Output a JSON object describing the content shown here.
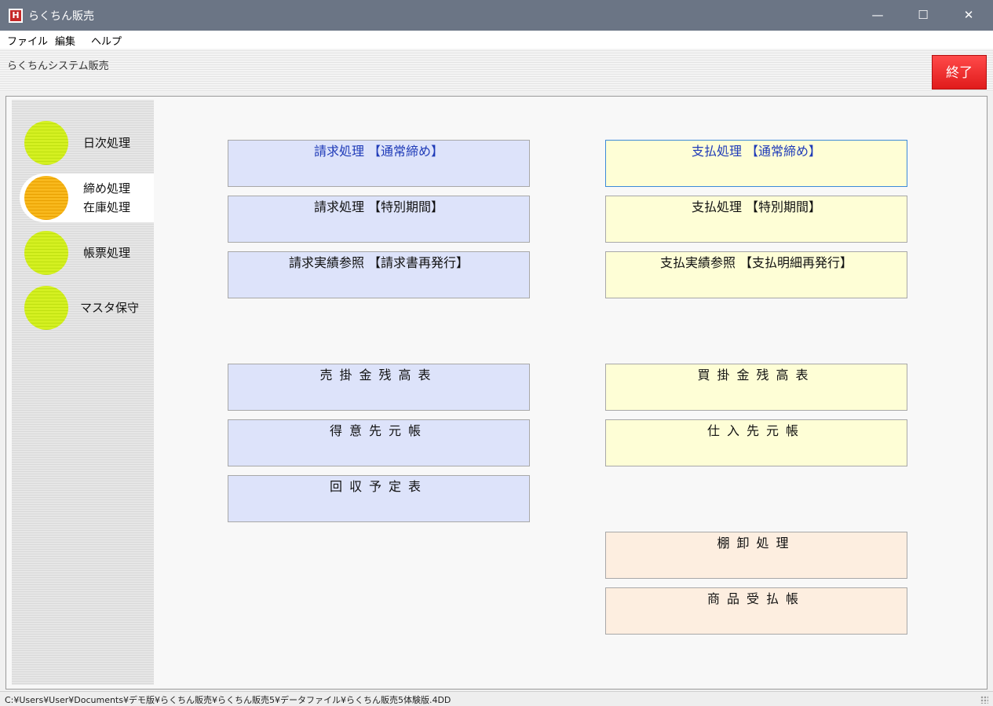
{
  "window": {
    "icon_letter": "H",
    "title": "らくちん販売",
    "minimize_glyph": "—",
    "maximize_glyph": "☐",
    "close_glyph": "✕"
  },
  "menu": {
    "items": [
      {
        "label": "ファイル"
      },
      {
        "label": "編集"
      },
      {
        "label": "ヘルプ"
      }
    ]
  },
  "header": {
    "system_name": "らくちんシステム販売",
    "exit_label": "終了",
    "exit_color": "#ee2222"
  },
  "sidebar": {
    "items": [
      {
        "label": "日次処理",
        "active": false,
        "color": "#ccea1a"
      },
      {
        "label_line1": "締め処理",
        "label_line2": "在庫処理",
        "active": true,
        "color": "#f5b01a"
      },
      {
        "label": "帳票処理",
        "active": false,
        "color": "#ccea1a"
      },
      {
        "label": "マスタ保守",
        "active": false,
        "color": "#ccea1a"
      }
    ]
  },
  "buttons": {
    "left": [
      {
        "label": "請求処理 【通常締め】"
      },
      {
        "label": "請求処理 【特別期間】"
      },
      {
        "label": "請求実績参照 【請求書再発行】"
      },
      {
        "label": "売掛金残高表"
      },
      {
        "label": "得意先元帳"
      },
      {
        "label": "回収予定表"
      }
    ],
    "right": [
      {
        "label": "支払処理 【通常締め】"
      },
      {
        "label": "支払処理 【特別期間】"
      },
      {
        "label": "支払実績参照 【支払明細再発行】"
      },
      {
        "label": "買掛金残高表"
      },
      {
        "label": "仕入先元帳"
      },
      {
        "label": "棚卸処理"
      },
      {
        "label": "商品受払帳"
      }
    ],
    "colors": {
      "left_bg": "#dde3fa",
      "right_bg": "#fefed6",
      "inventory_bg": "#fdeee0",
      "highlight_text": "#1f3bb8"
    }
  },
  "status": {
    "path": "C:¥Users¥User¥Documents¥デモ版¥らくちん販売¥らくちん販売5¥データファイル¥らくちん販売5体験版.4DD"
  }
}
